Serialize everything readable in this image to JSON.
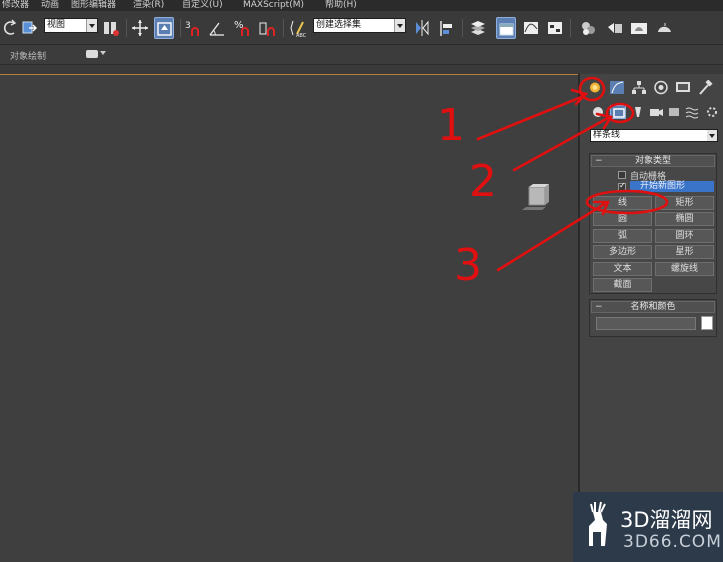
{
  "menu": {
    "items": [
      "修改器",
      "动画",
      "图形编辑器",
      "渲染(R)",
      "自定义(U)",
      "MAXScript(M)",
      "帮助(H)"
    ]
  },
  "toolbar": {
    "view_combo": "视图",
    "selection_set_combo": "创建选择集"
  },
  "ribbon": {
    "label": "对象绘制"
  },
  "command_panel": {
    "category_select": "样条线",
    "object_type": {
      "title": "对象类型",
      "auto_grid_label": "自动栅格",
      "start_new_shape_label": "开始新图形",
      "buttons": [
        "线",
        "矩形",
        "圆",
        "椭圆",
        "弧",
        "圆环",
        "多边形",
        "星形",
        "文本",
        "螺旋线",
        "截面"
      ]
    },
    "name_and_color": {
      "title": "名称和颜色"
    }
  },
  "annotations": {
    "labels": [
      "1",
      "2",
      "3"
    ],
    "color": "#e01010"
  },
  "watermark": {
    "title": "3D溜溜网",
    "subtitle": "3D66.COM"
  },
  "colors": {
    "viewport_bg": "#3f3f3f",
    "panel_bg": "#444444",
    "highlight_blue": "#3a74c8",
    "viewport_border": "#b3813b"
  }
}
